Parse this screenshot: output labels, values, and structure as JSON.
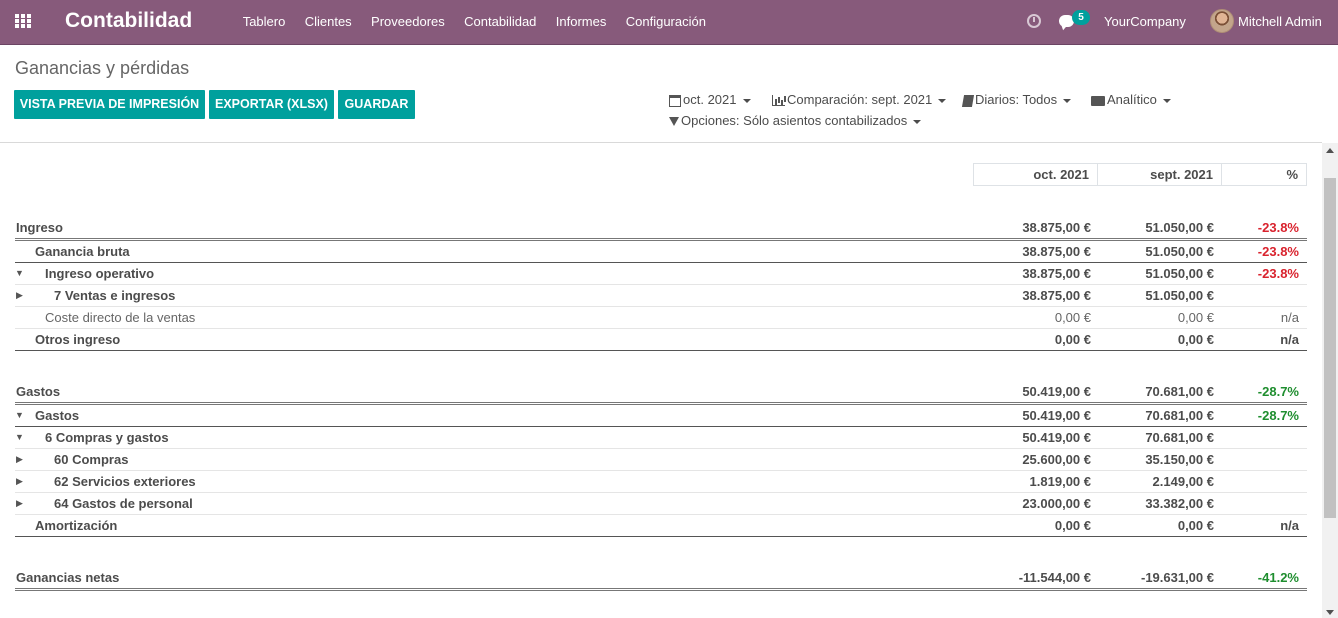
{
  "navbar": {
    "brand": "Contabilidad",
    "menu": [
      "Tablero",
      "Clientes",
      "Proveedores",
      "Contabilidad",
      "Informes",
      "Configuración"
    ],
    "chat_count": "5",
    "company": "YourCompany",
    "user": "Mitchell Admin"
  },
  "page": {
    "title": "Ganancias y pérdidas",
    "buttons": {
      "print": "VISTA PREVIA DE IMPRESIÓN",
      "export": "EXPORTAR (XLSX)",
      "save": "GUARDAR"
    },
    "filters": {
      "date": "oct. 2021",
      "comparison": "Comparación: sept. 2021",
      "journals": "Diarios: Todos",
      "analytic": "Analítico",
      "options": "Opciones: Sólo asientos contabilizados"
    }
  },
  "report": {
    "columns": [
      "oct. 2021",
      "sept. 2021",
      "%"
    ],
    "rows": [
      {
        "label": "Ingreso",
        "v1": "38.875,00 €",
        "v2": "51.050,00 €",
        "pct": "-23.8%"
      },
      {
        "label": "Ganancia bruta",
        "v1": "38.875,00 €",
        "v2": "51.050,00 €",
        "pct": "-23.8%"
      },
      {
        "label": "Ingreso operativo",
        "v1": "38.875,00 €",
        "v2": "51.050,00 €",
        "pct": "-23.8%"
      },
      {
        "label": "7 Ventas e ingresos",
        "v1": "38.875,00 €",
        "v2": "51.050,00 €",
        "pct": ""
      },
      {
        "label": "Coste directo de la ventas",
        "v1": "0,00 €",
        "v2": "0,00 €",
        "pct": "n/a"
      },
      {
        "label": "Otros ingreso",
        "v1": "0,00 €",
        "v2": "0,00 €",
        "pct": "n/a"
      },
      {
        "label": "Gastos",
        "v1": "50.419,00 €",
        "v2": "70.681,00 €",
        "pct": "-28.7%"
      },
      {
        "label": "Gastos",
        "v1": "50.419,00 €",
        "v2": "70.681,00 €",
        "pct": "-28.7%"
      },
      {
        "label": "6 Compras y gastos",
        "v1": "50.419,00 €",
        "v2": "70.681,00 €",
        "pct": ""
      },
      {
        "label": "60 Compras",
        "v1": "25.600,00 €",
        "v2": "35.150,00 €",
        "pct": ""
      },
      {
        "label": "62 Servicios exteriores",
        "v1": "1.819,00 €",
        "v2": "2.149,00 €",
        "pct": ""
      },
      {
        "label": "64 Gastos de personal",
        "v1": "23.000,00 €",
        "v2": "33.382,00 €",
        "pct": ""
      },
      {
        "label": "Amortización",
        "v1": "0,00 €",
        "v2": "0,00 €",
        "pct": "n/a"
      },
      {
        "label": "Ganancias netas",
        "v1": "-11.544,00 €",
        "v2": "-19.631,00 €",
        "pct": "-41.2%"
      }
    ]
  },
  "colors": {
    "navbar": "#875a7b",
    "primary_button": "#00a09d",
    "negative": "#d9232e",
    "positive": "#1f8e2f"
  }
}
